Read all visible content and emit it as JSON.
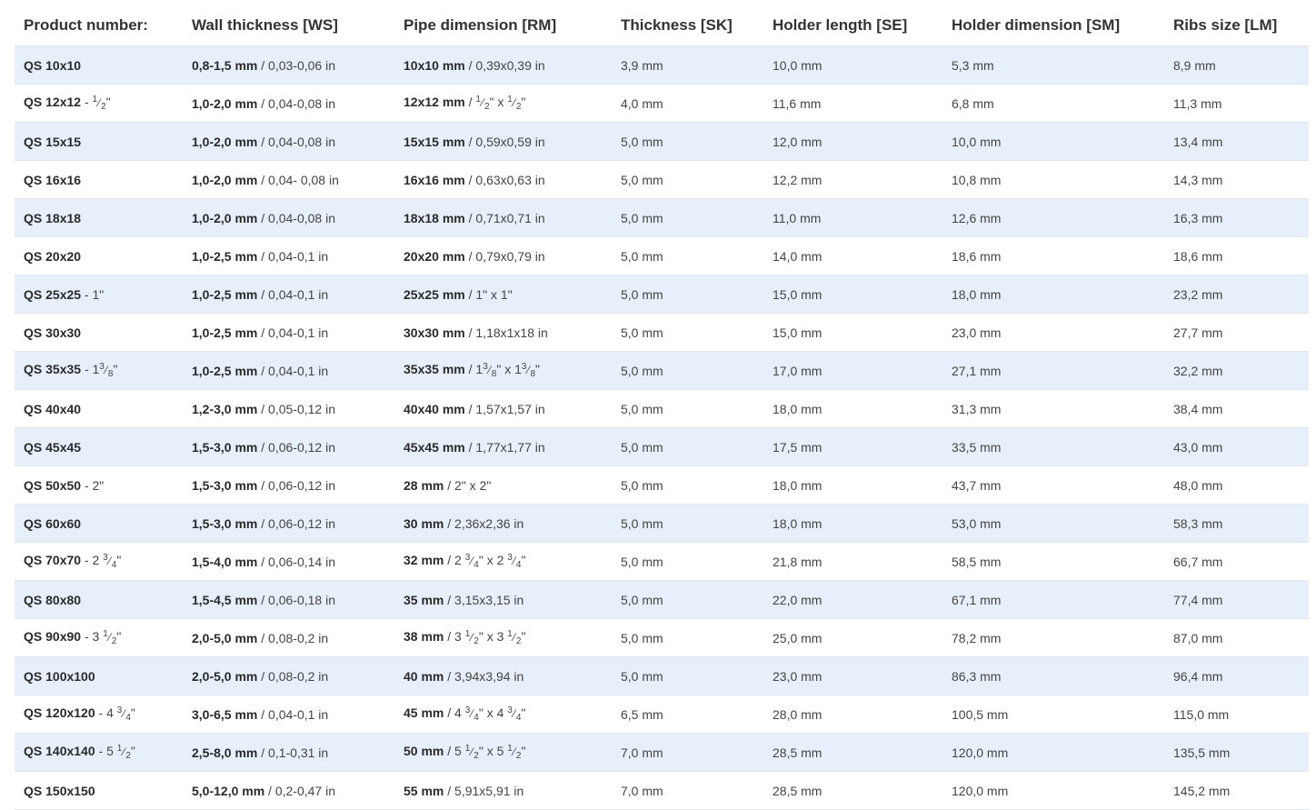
{
  "table": {
    "headers": [
      "Product number:",
      "Wall thickness [WS]",
      "Pipe dimension [RM]",
      "Thickness [SK]",
      "Holder length [SE]",
      "Holder dimension [SM]",
      "Ribs size [LM]"
    ],
    "rows": [
      {
        "product": [
          {
            "b": "QS 10x10"
          }
        ],
        "wall": [
          {
            "b": "0,8-1,5 mm"
          },
          {
            "t": " / 0,03-0,06 in"
          }
        ],
        "pipe": [
          {
            "b": "10x10 mm"
          },
          {
            "t": " / 0,39x0,39 in"
          }
        ],
        "thickness": "3,9 mm",
        "holder_length": "10,0 mm",
        "holder_dim": "5,3 mm",
        "ribs": "8,9 mm"
      },
      {
        "product": [
          {
            "b": "QS 12x12"
          },
          {
            "t": "  - "
          },
          {
            "n": "1",
            "d": "2"
          },
          {
            "t": "\""
          }
        ],
        "wall": [
          {
            "b": "1,0-2,0 mm"
          },
          {
            "t": " / 0,04-0,08 in"
          }
        ],
        "pipe": [
          {
            "b": "12x12 mm"
          },
          {
            "t": " / "
          },
          {
            "n": "1",
            "d": "2"
          },
          {
            "t": "\" x  "
          },
          {
            "n": "1",
            "d": "2"
          },
          {
            "t": "\""
          }
        ],
        "thickness": "4,0 mm",
        "holder_length": "11,6 mm",
        "holder_dim": "6,8 mm",
        "ribs": "11,3 mm"
      },
      {
        "product": [
          {
            "b": "QS 15x15"
          }
        ],
        "wall": [
          {
            "b": "1,0-2,0 mm"
          },
          {
            "t": " / 0,04-0,08 in"
          }
        ],
        "pipe": [
          {
            "b": "15x15 mm"
          },
          {
            "t": " / 0,59x0,59 in"
          }
        ],
        "thickness": "5,0 mm",
        "holder_length": "12,0 mm",
        "holder_dim": "10,0 mm",
        "ribs": "13,4 mm"
      },
      {
        "product": [
          {
            "b": "QS 16x16"
          }
        ],
        "wall": [
          {
            "b": "1,0-2,0 mm"
          },
          {
            "t": " / 0,04- 0,08 in"
          }
        ],
        "pipe": [
          {
            "b": "16x16 mm"
          },
          {
            "t": " / 0,63x0,63 in"
          }
        ],
        "thickness": "5,0 mm",
        "holder_length": "12,2 mm",
        "holder_dim": "10,8 mm",
        "ribs": "14,3 mm"
      },
      {
        "product": [
          {
            "b": "QS 18x18"
          }
        ],
        "wall": [
          {
            "b": "1,0-2,0 mm"
          },
          {
            "t": " / 0,04-0,08 in"
          }
        ],
        "pipe": [
          {
            "b": "18x18 mm"
          },
          {
            "t": " / 0,71x0,71 in"
          }
        ],
        "thickness": "5,0 mm",
        "holder_length": "11,0 mm",
        "holder_dim": "12,6 mm",
        "ribs": "16,3 mm"
      },
      {
        "product": [
          {
            "b": "QS 20x20"
          }
        ],
        "wall": [
          {
            "b": "1,0-2,5 mm"
          },
          {
            "t": " / 0,04-0,1 in"
          }
        ],
        "pipe": [
          {
            "b": "20x20 mm"
          },
          {
            "t": " / 0,79x0,79 in"
          }
        ],
        "thickness": "5,0 mm",
        "holder_length": "14,0 mm",
        "holder_dim": "18,6 mm",
        "ribs": "18,6 mm"
      },
      {
        "product": [
          {
            "b": "QS 25x25"
          },
          {
            "t": " - 1\""
          }
        ],
        "wall": [
          {
            "b": "1,0-2,5 mm"
          },
          {
            "t": " / 0,04-0,1 in"
          }
        ],
        "pipe": [
          {
            "b": "25x25 mm"
          },
          {
            "t": " / 1\" x 1\""
          }
        ],
        "thickness": "5,0 mm",
        "holder_length": "15,0 mm",
        "holder_dim": "18,0 mm",
        "ribs": "23,2 mm"
      },
      {
        "product": [
          {
            "b": "QS 30x30"
          }
        ],
        "wall": [
          {
            "b": "1,0-2,5 mm"
          },
          {
            "t": " / 0,04-0,1 in"
          }
        ],
        "pipe": [
          {
            "b": "30x30 mm"
          },
          {
            "t": " / 1,18x1x18 in"
          }
        ],
        "thickness": "5,0 mm",
        "holder_length": "15,0 mm",
        "holder_dim": "23,0 mm",
        "ribs": "27,7 mm"
      },
      {
        "product": [
          {
            "b": "QS 35x35"
          },
          {
            "t": " - 1"
          },
          {
            "n": "3",
            "d": "8"
          },
          {
            "t": "\""
          }
        ],
        "wall": [
          {
            "b": "1,0-2,5 mm"
          },
          {
            "t": " / 0,04-0,1 in"
          }
        ],
        "pipe": [
          {
            "b": "35x35 mm"
          },
          {
            "t": " / 1"
          },
          {
            "n": "3",
            "d": "8"
          },
          {
            "t": "\" x 1"
          },
          {
            "n": "3",
            "d": "8"
          },
          {
            "t": "\""
          }
        ],
        "thickness": "5,0 mm",
        "holder_length": "17,0 mm",
        "holder_dim": "27,1 mm",
        "ribs": "32,2 mm"
      },
      {
        "product": [
          {
            "b": "QS 40x40"
          }
        ],
        "wall": [
          {
            "b": "1,2-3,0 mm"
          },
          {
            "t": " / 0,05-0,12 in"
          }
        ],
        "pipe": [
          {
            "b": "40x40 mm"
          },
          {
            "t": " / 1,57x1,57 in"
          }
        ],
        "thickness": "5,0 mm",
        "holder_length": "18,0 mm",
        "holder_dim": "31,3 mm",
        "ribs": "38,4 mm"
      },
      {
        "product": [
          {
            "b": "QS 45x45"
          }
        ],
        "wall": [
          {
            "b": "1,5-3,0 mm"
          },
          {
            "t": " / 0,06-0,12 in"
          }
        ],
        "pipe": [
          {
            "b": "45x45 mm"
          },
          {
            "t": " / 1,77x1,77 in"
          }
        ],
        "thickness": "5,0 mm",
        "holder_length": "17,5 mm",
        "holder_dim": "33,5 mm",
        "ribs": "43,0 mm"
      },
      {
        "product": [
          {
            "b": "QS 50x50"
          },
          {
            "t": "  - 2\""
          }
        ],
        "wall": [
          {
            "b": "1,5-3,0 mm"
          },
          {
            "t": " / 0,06-0,12 in"
          }
        ],
        "pipe": [
          {
            "b": "28 mm"
          },
          {
            "t": " / 2\" x 2\""
          }
        ],
        "thickness": "5,0 mm",
        "holder_length": "18,0 mm",
        "holder_dim": "43,7 mm",
        "ribs": "48,0 mm"
      },
      {
        "product": [
          {
            "b": "QS 60x60"
          }
        ],
        "wall": [
          {
            "b": "1,5-3,0 mm"
          },
          {
            "t": " / 0,06-0,12 in"
          }
        ],
        "pipe": [
          {
            "b": "30 mm"
          },
          {
            "t": " / 2,36x2,36 in"
          }
        ],
        "thickness": "5,0 mm",
        "holder_length": "18,0 mm",
        "holder_dim": "53,0 mm",
        "ribs": "58,3 mm"
      },
      {
        "product": [
          {
            "b": "QS 70x70"
          },
          {
            "t": " - 2 "
          },
          {
            "n": "3",
            "d": "4"
          },
          {
            "t": "\""
          }
        ],
        "wall": [
          {
            "b": "1,5-4,0 mm"
          },
          {
            "t": " / 0,06-0,14 in"
          }
        ],
        "pipe": [
          {
            "b": "32 mm"
          },
          {
            "t": " / 2 "
          },
          {
            "n": "3",
            "d": "4"
          },
          {
            "t": "\" x 2 "
          },
          {
            "n": "3",
            "d": "4"
          },
          {
            "t": "\""
          }
        ],
        "thickness": "5,0 mm",
        "holder_length": "21,8 mm",
        "holder_dim": "58,5 mm",
        "ribs": "66,7 mm"
      },
      {
        "product": [
          {
            "b": "QS 80x80"
          }
        ],
        "wall": [
          {
            "b": "1,5-4,5 mm"
          },
          {
            "t": " / 0,06-0,18 in"
          }
        ],
        "pipe": [
          {
            "b": "35 mm"
          },
          {
            "t": " / 3,15x3,15 in"
          }
        ],
        "thickness": "5,0 mm",
        "holder_length": "22,0 mm",
        "holder_dim": "67,1 mm",
        "ribs": "77,4 mm"
      },
      {
        "product": [
          {
            "b": "QS 90x90"
          },
          {
            "t": " -   3 "
          },
          {
            "n": "1",
            "d": "2"
          },
          {
            "t": "\""
          }
        ],
        "wall": [
          {
            "b": "2,0-5,0 mm"
          },
          {
            "t": " / 0,08-0,2 in"
          }
        ],
        "pipe": [
          {
            "b": "38 mm"
          },
          {
            "t": " / 3 "
          },
          {
            "n": "1",
            "d": "2"
          },
          {
            "t": "\" x 3 "
          },
          {
            "n": "1",
            "d": "2"
          },
          {
            "t": "\""
          }
        ],
        "thickness": "5,0 mm",
        "holder_length": "25,0 mm",
        "holder_dim": "78,2 mm",
        "ribs": "87,0 mm"
      },
      {
        "product": [
          {
            "b": "QS 100x100"
          }
        ],
        "wall": [
          {
            "b": "2,0-5,0 mm"
          },
          {
            "t": " / 0,08-0,2 in"
          }
        ],
        "pipe": [
          {
            "b": "40 mm"
          },
          {
            "t": " / 3,94x3,94 in"
          }
        ],
        "thickness": "5,0 mm",
        "holder_length": "23,0 mm",
        "holder_dim": "86,3 mm",
        "ribs": "96,4 mm"
      },
      {
        "product": [
          {
            "b": "QS 120x120"
          },
          {
            "t": " - 4 "
          },
          {
            "n": "3",
            "d": "4"
          },
          {
            "t": "\""
          }
        ],
        "wall": [
          {
            "b": "3,0-6,5 mm"
          },
          {
            "t": " / 0,04-0,1 in"
          }
        ],
        "pipe": [
          {
            "b": "45 mm"
          },
          {
            "t": " / 4 "
          },
          {
            "n": "3",
            "d": "4"
          },
          {
            "t": "\" x 4 "
          },
          {
            "n": "3",
            "d": "4"
          },
          {
            "t": "\""
          }
        ],
        "thickness": "6,5 mm",
        "holder_length": "28,0 mm",
        "holder_dim": "100,5 mm",
        "ribs": "115,0 mm"
      },
      {
        "product": [
          {
            "b": "QS 140x140"
          },
          {
            "t": " - 5 "
          },
          {
            "n": "1",
            "d": "2"
          },
          {
            "t": "\""
          }
        ],
        "wall": [
          {
            "b": "2,5-8,0 mm"
          },
          {
            "t": " / 0,1-0,31 in"
          }
        ],
        "pipe": [
          {
            "b": "50 mm"
          },
          {
            "t": " / 5 "
          },
          {
            "n": "1",
            "d": "2"
          },
          {
            "t": "\" x 5 "
          },
          {
            "n": "1",
            "d": "2"
          },
          {
            "t": "\""
          }
        ],
        "thickness": "7,0 mm",
        "holder_length": "28,5 mm",
        "holder_dim": "120,0 mm",
        "ribs": "135,5 mm"
      },
      {
        "product": [
          {
            "b": "QS 150x150"
          }
        ],
        "wall": [
          {
            "b": "5,0-12,0 mm"
          },
          {
            "t": " / 0,2-0,47 in"
          }
        ],
        "pipe": [
          {
            "b": "55 mm"
          },
          {
            "t": " / 5,91x5,91 in"
          }
        ],
        "thickness": "7,0 mm",
        "holder_length": "28,5 mm",
        "holder_dim": "120,0 mm",
        "ribs": "145,2 mm"
      }
    ]
  }
}
